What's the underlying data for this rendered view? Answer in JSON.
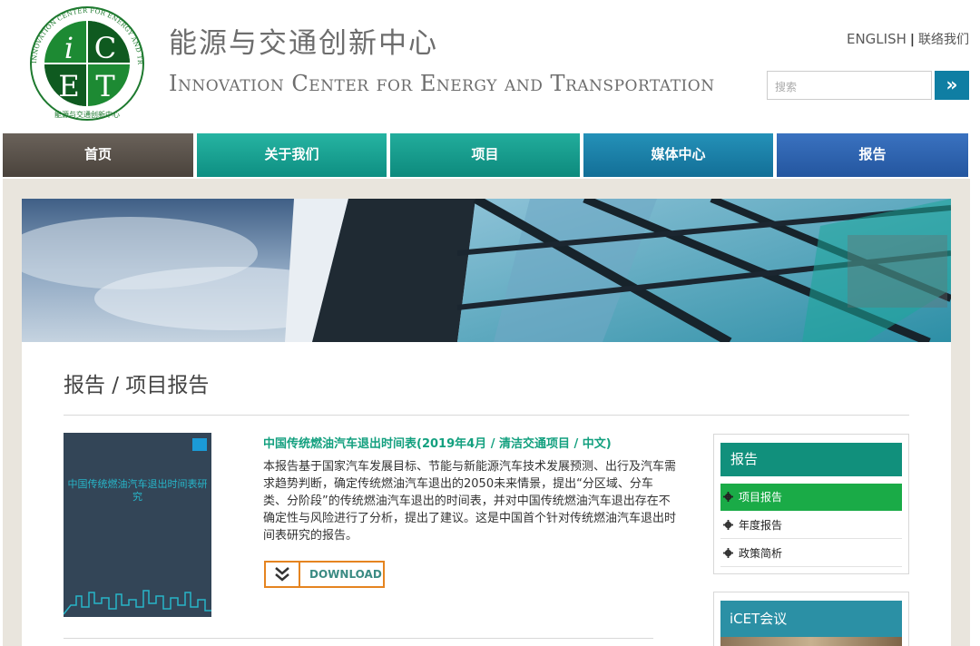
{
  "logo": {
    "ring_text": "INNOVATION CENTER FOR ENERGY AND TRANSPORTATION",
    "ring_text_cn": "能源与交通创新中心",
    "letters": [
      "i",
      "C",
      "E",
      "T"
    ],
    "colors": {
      "green": "#1e7a2f",
      "dark": "#0d4a1a"
    }
  },
  "header": {
    "title_cn": "能源与交通创新中心",
    "title_en": "Innovation Center for Energy and Transportation",
    "lang_link": "ENGLISH",
    "divider": "|",
    "contact_link": "联络我们",
    "search_placeholder": "搜索",
    "search_button": "»"
  },
  "nav": {
    "items": [
      {
        "label": "首页"
      },
      {
        "label": "关于我们"
      },
      {
        "label": "项目"
      },
      {
        "label": "媒体中心"
      },
      {
        "label": "报告"
      }
    ]
  },
  "page": {
    "breadcrumb": "报告 / 项目报告"
  },
  "report": {
    "title": "中国传统燃油汽车退出时间表(2019年4月 / 清洁交通项目 / 中文)",
    "body": "本报告基于国家汽车发展目标、节能与新能源汽车技术发展预测、出行及汽车需求趋势判断，确定传统燃油汽车退出的2050未来情景，提出“分区域、分车类、分阶段”的传统燃油汽车退出的时间表，并对中国传统燃油汽车退出存在不确定性与风险进行了分析，提出了建议。这是中国首个针对传统燃油汽车退出时间表研究的报告。",
    "download_label": "DOWNLOAD",
    "cover": {
      "title": "中国传统燃油汽车退出时间表研究",
      "colors": {
        "bg": "#334557",
        "title": "#27b5c8"
      }
    }
  },
  "sidebar": {
    "heading": "报告",
    "items": [
      {
        "label": "项目报告",
        "active": true
      },
      {
        "label": "年度报告",
        "active": false
      },
      {
        "label": "政策简析",
        "active": false
      }
    ],
    "heading2": "iCET会议"
  },
  "colors": {
    "accent_green": "#13a07f",
    "download_orange": "#e58420",
    "search_blue": "#0f7ea3"
  }
}
